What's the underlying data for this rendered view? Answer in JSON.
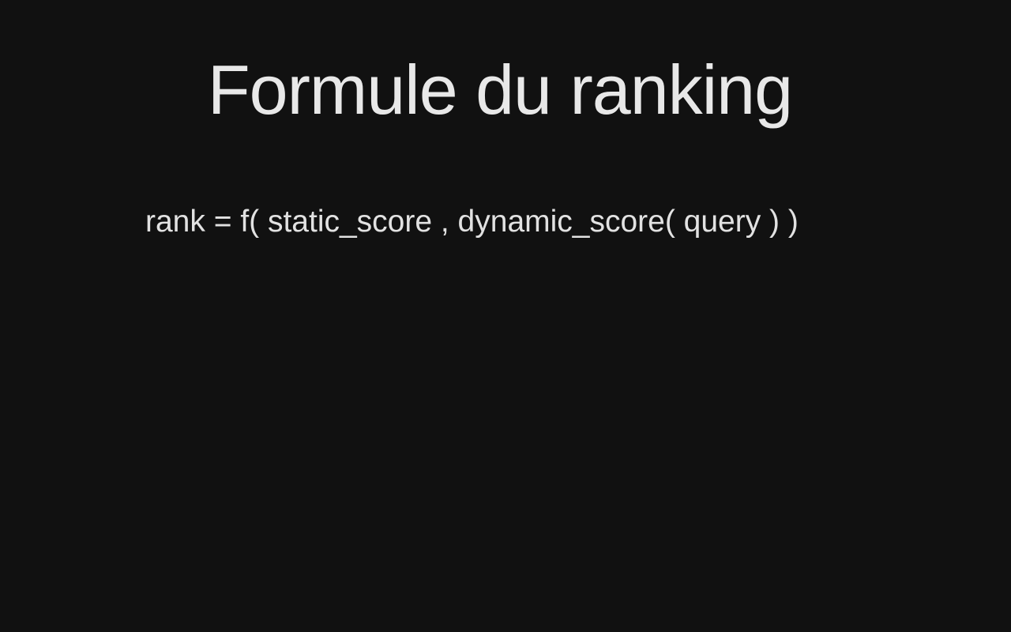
{
  "slide": {
    "title": "Formule du ranking",
    "formula": "rank = f( static_score , dynamic_score( query ) )"
  }
}
